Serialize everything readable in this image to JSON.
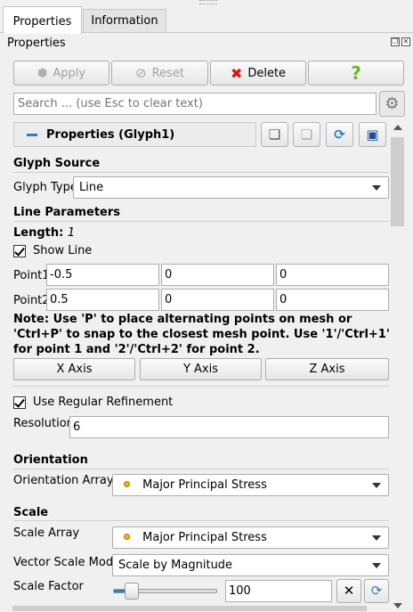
{
  "tabs": [
    {
      "label": "Properties",
      "active": true
    },
    {
      "label": "Information",
      "active": false
    }
  ],
  "panel_title": "Properties",
  "toolbar": {
    "apply_label": "Apply",
    "reset_label": "Reset",
    "delete_label": "Delete",
    "help_label": "?"
  },
  "search": {
    "placeholder": "Search ... (use Esc to clear text)"
  },
  "properties_header": "Properties (Glyph1)",
  "glyph_source": {
    "section_title": "Glyph Source",
    "glyph_type_label": "Glyph Type",
    "glyph_type_value": "Line"
  },
  "line_parameters": {
    "section_title": "Line Parameters",
    "length_label": "Length:",
    "length_value": "1",
    "show_line_label": "Show Line",
    "show_line_checked": true,
    "point1_label": "Point1",
    "point1": [
      "-0.5",
      "0",
      "0"
    ],
    "point2_label": "Point2",
    "point2": [
      "0.5",
      "0",
      "0"
    ],
    "note": "Note: Use 'P' to place alternating points on mesh or 'Ctrl+P' to snap to the closest mesh point. Use '1'/'Ctrl+1' for point 1 and '2'/'Ctrl+2' for point 2.",
    "axis_buttons": [
      "X Axis",
      "Y Axis",
      "Z Axis"
    ],
    "use_regular_refinement_label": "Use Regular Refinement",
    "use_regular_refinement_checked": true,
    "resolution_label": "Resolution",
    "resolution_value": "6"
  },
  "orientation": {
    "section_title": "Orientation",
    "array_label": "Orientation Array",
    "array_value": "Major Principal Stress"
  },
  "scale": {
    "section_title": "Scale",
    "array_label": "Scale Array",
    "array_value": "Major Principal Stress",
    "vector_mode_label": "Vector Scale Mode",
    "vector_mode_value": "Scale by Magnitude",
    "factor_label": "Scale Factor",
    "factor_value": "100"
  },
  "colors": {
    "accent": "#2a7fc7",
    "delete": "#dd1111",
    "help": "#6bb32e",
    "array_dot": "#f0b400"
  }
}
